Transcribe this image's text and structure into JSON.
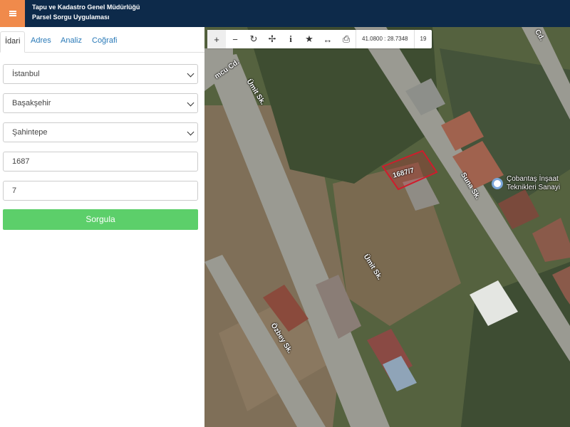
{
  "header": {
    "title_line1": "Tapu ve Kadastro Genel Müdürlüğü",
    "title_line2": "Parsel Sorgu Uygulaması"
  },
  "tabs": [
    {
      "label": "İdari",
      "active": true
    },
    {
      "label": "Adres",
      "active": false
    },
    {
      "label": "Analiz",
      "active": false
    },
    {
      "label": "Coğrafi",
      "active": false
    }
  ],
  "form": {
    "province": "İstanbul",
    "district": "Başakşehir",
    "neighborhood": "Şahintepe",
    "block": "1687",
    "parcel": "7",
    "submit_label": "Sorgula"
  },
  "map_toolbar": {
    "coordinates": "41.0800 : 28.7348",
    "zoom": "19",
    "icons": [
      "zoom-in-icon",
      "zoom-out-icon",
      "refresh-icon",
      "move-icon",
      "info-icon",
      "star-icon",
      "measure-icon",
      "print-icon"
    ]
  },
  "map": {
    "parcel_label": "1687/7",
    "streets": [
      "Ümit Sk.",
      "Ümit Sk.",
      "Suna Sk.",
      "Özbey Sk.",
      "mcu Cd.",
      "Cd."
    ],
    "poi_line1": "Çobantaş İnşaat",
    "poi_line2": "Teknikleri Sanayi"
  },
  "colors": {
    "header_bg": "#0d2a4a",
    "menu_accent": "#f08a4b",
    "submit_green": "#5ccf6a",
    "parcel_outline": "#d01c2c"
  }
}
